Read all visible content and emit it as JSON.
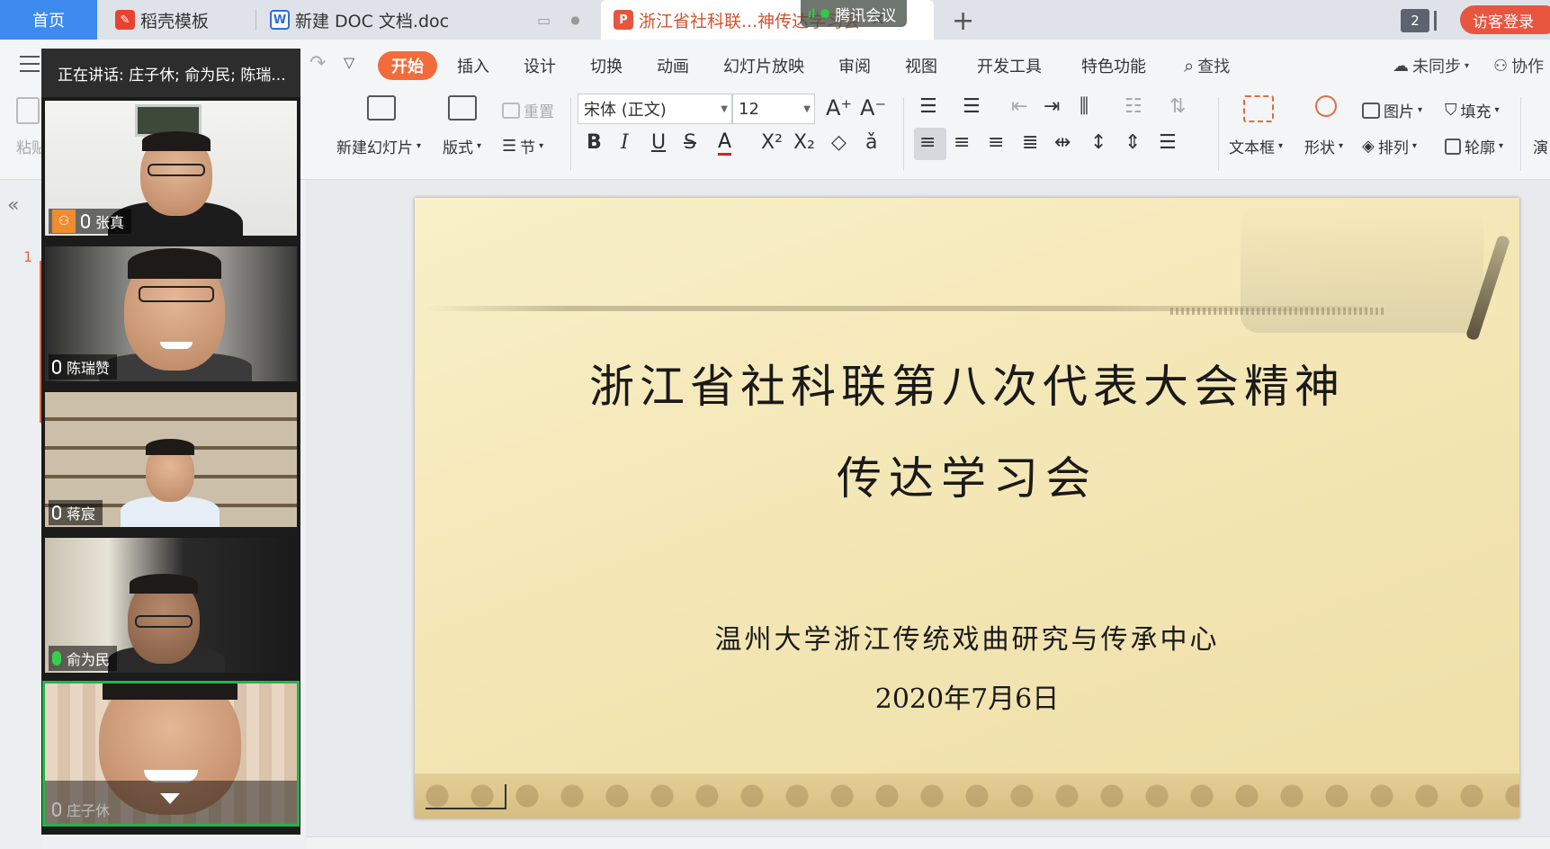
{
  "tabs": {
    "home": "首页",
    "template": "稻壳模板",
    "doc": "新建 DOC 文档.doc",
    "ppt": "浙江省社科联...神传达学习会",
    "new_tab": "+"
  },
  "meeting_badge": "腾讯会议",
  "window_count": "2",
  "guest_login": "访客登录",
  "menu": {
    "items": [
      "开始",
      "插入",
      "设计",
      "切换",
      "动画",
      "幻灯片放映",
      "审阅",
      "视图",
      "开发工具",
      "特色功能"
    ],
    "search": "查找",
    "sync": "未同步",
    "collab": "协作"
  },
  "ribbon": {
    "paste": "粘贴",
    "new_slide": "新建幻灯片",
    "layout": "版式",
    "reset": "重置",
    "section": "节",
    "font_name": "宋体 (正文)",
    "font_size": "12",
    "text_box": "文本框",
    "shape": "形状",
    "picture": "图片",
    "arrange": "排列",
    "fill": "填充",
    "outline": "轮廓",
    "play": "演"
  },
  "thumbnails": {
    "slide_number": "1"
  },
  "slide": {
    "title_line1": "浙江省社科联第八次代表大会精神",
    "title_line2": "传达学习会",
    "organizer": "温州大学浙江传统戏曲研究与传承中心",
    "date": "2020年7月6日"
  },
  "meeting": {
    "speaking": "正在讲话: 庄子休; 俞为民; 陈瑞...",
    "participants": [
      {
        "name": "张真",
        "host": true
      },
      {
        "name": "陈瑞赞",
        "host": false
      },
      {
        "name": "蒋宸",
        "host": false
      },
      {
        "name": "俞为民",
        "host": false
      },
      {
        "name": "庄子休",
        "host": false
      }
    ]
  },
  "colors": {
    "accent": "#f26b3a",
    "home_tab": "#3e8bf0",
    "login": "#e8553f",
    "speaking_green": "#35d04b"
  }
}
